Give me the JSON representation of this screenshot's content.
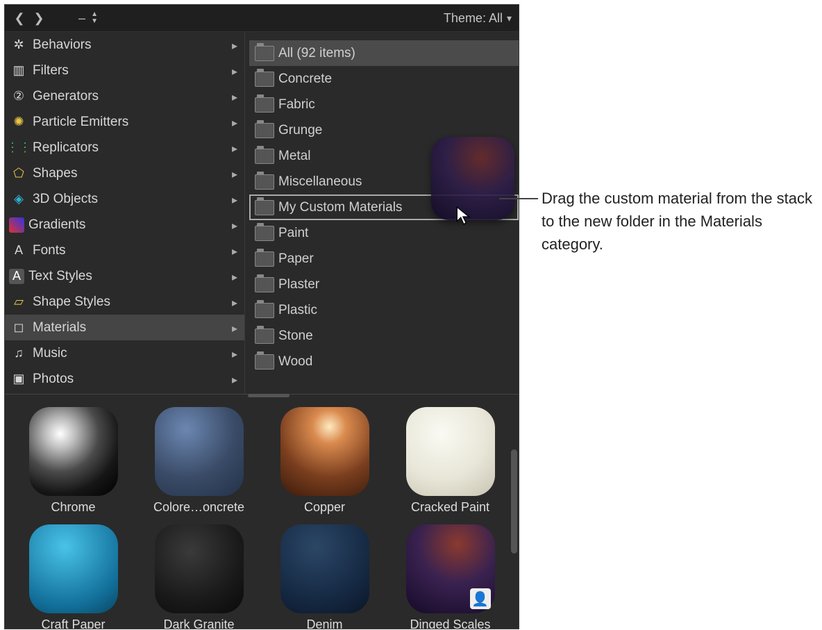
{
  "topbar": {
    "theme_label": "Theme: All"
  },
  "categories": [
    {
      "label": "Behaviors",
      "icon": "gear-icon",
      "glyph": "✲"
    },
    {
      "label": "Filters",
      "icon": "filter-icon",
      "glyph": "▥"
    },
    {
      "label": "Generators",
      "icon": "generators-icon",
      "glyph": "②"
    },
    {
      "label": "Particle Emitters",
      "icon": "particle-icon",
      "glyph": "✺"
    },
    {
      "label": "Replicators",
      "icon": "replicators-icon",
      "glyph": "⋮⋮"
    },
    {
      "label": "Shapes",
      "icon": "shapes-icon",
      "glyph": "⬠"
    },
    {
      "label": "3D Objects",
      "icon": "3d-icon",
      "glyph": "◈"
    },
    {
      "label": "Gradients",
      "icon": "gradients-icon",
      "glyph": "▦"
    },
    {
      "label": "Fonts",
      "icon": "fonts-icon",
      "glyph": "A"
    },
    {
      "label": "Text Styles",
      "icon": "text-styles-icon",
      "glyph": "A"
    },
    {
      "label": "Shape Styles",
      "icon": "shape-styles-icon",
      "glyph": "▱"
    },
    {
      "label": "Materials",
      "icon": "materials-icon",
      "glyph": "◻",
      "selected": true
    },
    {
      "label": "Music",
      "icon": "music-icon",
      "glyph": "♫"
    },
    {
      "label": "Photos",
      "icon": "photos-icon",
      "glyph": "▣"
    }
  ],
  "subfolders": [
    {
      "label": "All (92 items)",
      "selected": true
    },
    {
      "label": "Concrete"
    },
    {
      "label": "Fabric"
    },
    {
      "label": "Grunge"
    },
    {
      "label": "Metal"
    },
    {
      "label": "Miscellaneous"
    },
    {
      "label": "My Custom Materials",
      "drop_target": true
    },
    {
      "label": "Paint"
    },
    {
      "label": "Paper"
    },
    {
      "label": "Plaster"
    },
    {
      "label": "Plastic"
    },
    {
      "label": "Stone"
    },
    {
      "label": "Wood"
    }
  ],
  "materials": [
    {
      "label": "Chrome",
      "thumb": "t-chrome"
    },
    {
      "label": "Colore…oncrete",
      "thumb": "t-concrete"
    },
    {
      "label": "Copper",
      "thumb": "t-copper"
    },
    {
      "label": "Cracked Paint",
      "thumb": "t-cracked"
    },
    {
      "label": "Craft Paper",
      "thumb": "t-craft"
    },
    {
      "label": "Dark Granite",
      "thumb": "t-granite"
    },
    {
      "label": "Denim",
      "thumb": "t-denim"
    },
    {
      "label": "Dinged Scales",
      "thumb": "t-scales",
      "user_badge": true
    }
  ],
  "callout": "Drag the custom material from the stack to the new folder in the Materials category."
}
